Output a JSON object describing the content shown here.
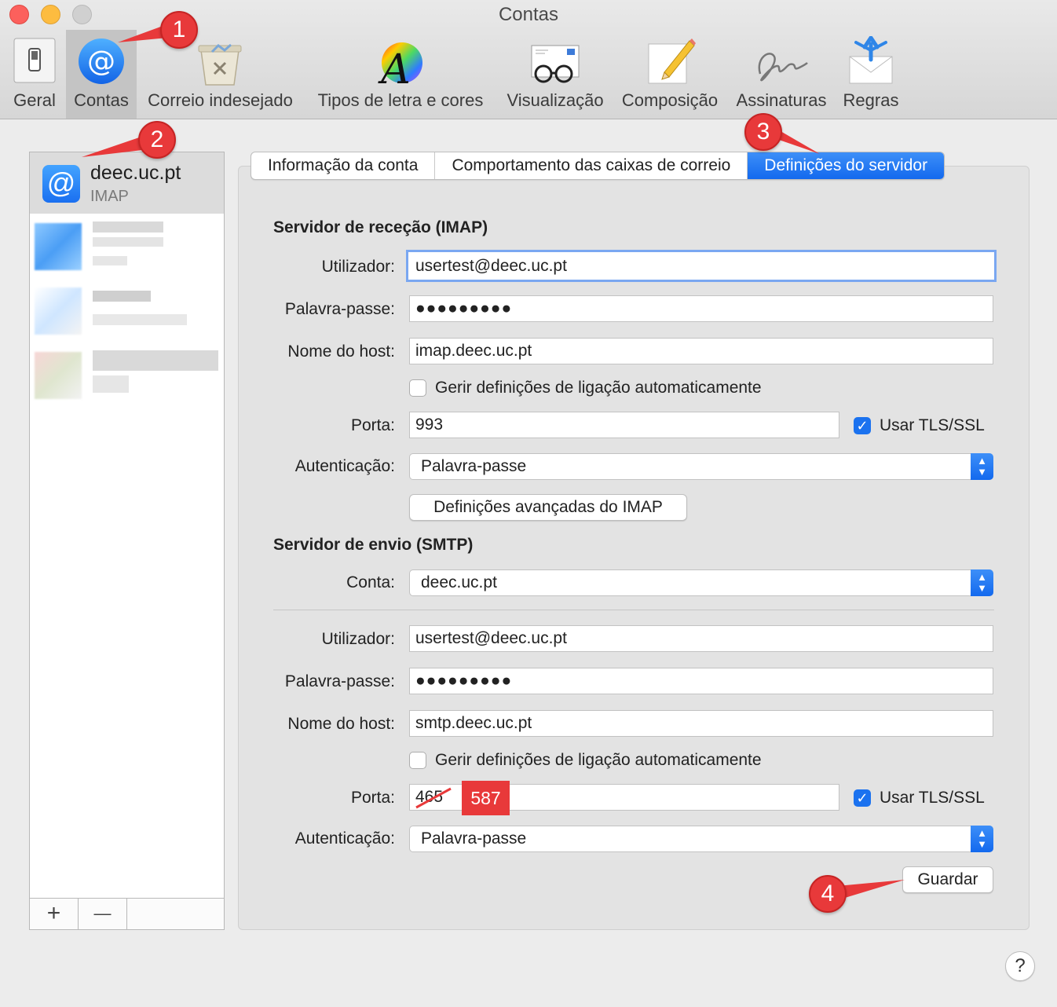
{
  "window": {
    "title": "Contas"
  },
  "toolbar": {
    "items": [
      {
        "label": "Geral",
        "icon": "switch-icon"
      },
      {
        "label": "Contas",
        "icon": "at-sign-icon",
        "selected": true
      },
      {
        "label": "Correio indesejado",
        "icon": "junk-trash-icon"
      },
      {
        "label": "Tipos de letra e cores",
        "icon": "font-color-icon"
      },
      {
        "label": "Visualização",
        "icon": "glasses-icon"
      },
      {
        "label": "Composição",
        "icon": "pencil-paper-icon"
      },
      {
        "label": "Assinaturas",
        "icon": "signature-icon"
      },
      {
        "label": "Regras",
        "icon": "rules-envelope-icon"
      }
    ]
  },
  "annotations": {
    "step1": "1",
    "step2": "2",
    "step3": "3",
    "step4": "4",
    "annotation_color": "#e8393a"
  },
  "sidebar": {
    "account": {
      "name": "deec.uc.pt",
      "type": "IMAP",
      "icon_glyph": "@"
    },
    "add_label": "+",
    "remove_label": "—"
  },
  "tabs": {
    "account_info": "Informação da conta",
    "mailbox_behavior": "Comportamento das caixas de correio",
    "server_settings": "Definições do servidor",
    "active_color": "#1b72ef"
  },
  "incoming": {
    "title": "Servidor de receção (IMAP)",
    "user_label": "Utilizador:",
    "user_value": "usertest@deec.uc.pt",
    "password_label": "Palavra-passe:",
    "password_value": "●●●●●●●●●",
    "host_label": "Nome do host:",
    "host_value": "imap.deec.uc.pt",
    "auto_manage_label": "Gerir definições de ligação automaticamente",
    "auto_manage_checked": false,
    "port_label": "Porta:",
    "port_value": "993",
    "tls_label": "Usar TLS/SSL",
    "tls_checked": true,
    "auth_label": "Autenticação:",
    "auth_value": "Palavra-passe",
    "advanced_button": "Definições avançadas do IMAP"
  },
  "outgoing": {
    "title": "Servidor de envio (SMTP)",
    "account_label": "Conta:",
    "account_value": "deec.uc.pt",
    "user_label": "Utilizador:",
    "user_value": "usertest@deec.uc.pt",
    "password_label": "Palavra-passe:",
    "password_value": "●●●●●●●●●",
    "host_label": "Nome do host:",
    "host_value": "smtp.deec.uc.pt",
    "auto_manage_label": "Gerir definições de ligação automaticamente",
    "auto_manage_checked": false,
    "port_label": "Porta:",
    "port_old_value": "465",
    "port_new_value": "587",
    "tls_label": "Usar TLS/SSL",
    "tls_checked": true,
    "auth_label": "Autenticação:",
    "auth_value": "Palavra-passe"
  },
  "actions": {
    "save_button": "Guardar",
    "help_button": "?"
  }
}
